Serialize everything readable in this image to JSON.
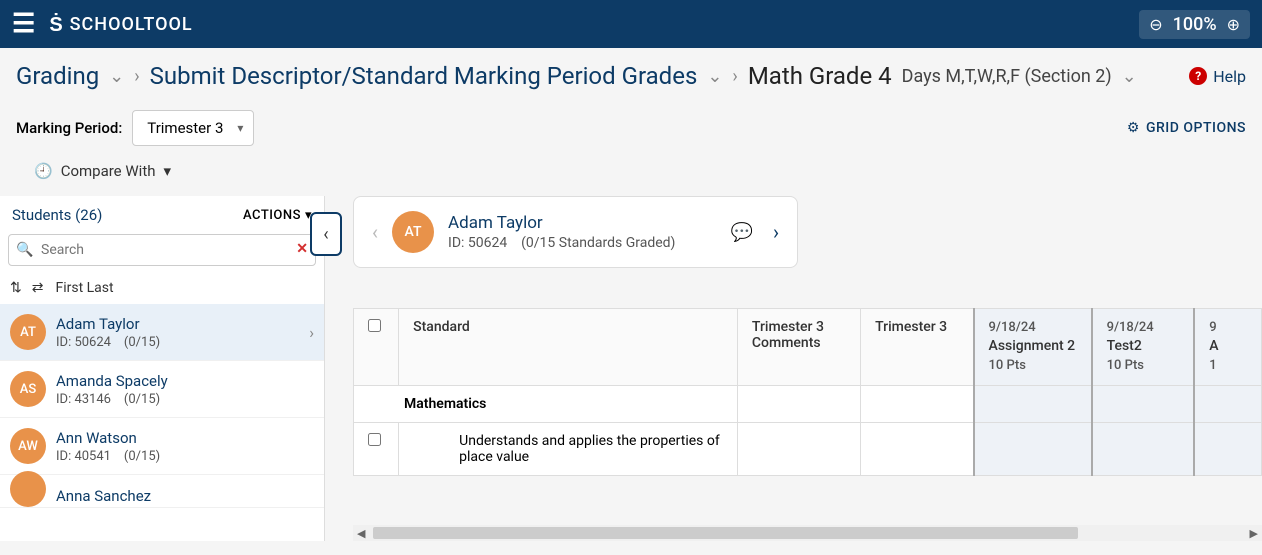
{
  "app": {
    "brand": "SCHOOLTOOL",
    "zoom": "100%"
  },
  "breadcrumb": {
    "grading": "Grading",
    "submit": "Submit Descriptor/Standard Marking Period Grades",
    "course": "Math Grade 4",
    "schedule": "Days M,T,W,R,F (Section 2)",
    "help": "Help"
  },
  "controls": {
    "mp_label": "Marking Period:",
    "mp_value": "Trimester 3",
    "grid_options": "GRID OPTIONS",
    "compare": "Compare With"
  },
  "sidebar": {
    "students_label": "Students (26)",
    "actions": "ACTIONS",
    "search_placeholder": "Search",
    "sort_label": "First Last",
    "students": [
      {
        "initials": "AT",
        "name": "Adam Taylor",
        "id": "ID: 50624",
        "progress": "(0/15)",
        "selected": true
      },
      {
        "initials": "AS",
        "name": "Amanda Spacely",
        "id": "ID: 43146",
        "progress": "(0/15)",
        "selected": false
      },
      {
        "initials": "AW",
        "name": "Ann Watson",
        "id": "ID: 40541",
        "progress": "(0/15)",
        "selected": false
      },
      {
        "initials": "",
        "name": "Anna Sanchez",
        "id": "",
        "progress": "",
        "selected": false
      }
    ]
  },
  "current_student": {
    "initials": "AT",
    "name": "Adam Taylor",
    "id": "ID: 50624",
    "graded": "(0/15 Standards Graded)"
  },
  "grid": {
    "headers": {
      "standard": "Standard",
      "t3comments": "Trimester 3\nComments",
      "t3": "Trimester 3",
      "col1_date": "9/18/24",
      "col1_name": "Assignment 2",
      "col1_pts": "10 Pts",
      "col2_date": "9/18/24",
      "col2_name": "Test2",
      "col2_pts": "10 Pts",
      "col3_date": "9",
      "col3_name": "A",
      "col3_pts": "1"
    },
    "subject": "Mathematics",
    "standard1": "Understands and applies the properties of place value"
  }
}
